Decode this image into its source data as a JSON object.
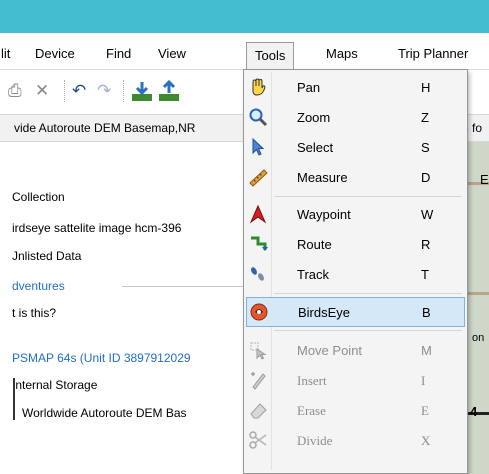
{
  "menubar": {
    "items": [
      {
        "label": "lit"
      },
      {
        "label": "Device"
      },
      {
        "label": "Find"
      },
      {
        "label": "View"
      },
      {
        "label": "Tools"
      },
      {
        "label": "Maps"
      },
      {
        "label": "Trip Planner"
      }
    ]
  },
  "toolbar": {
    "icons": [
      "print-icon",
      "delete-icon",
      "undo-icon",
      "redo-icon",
      "receive-from-device-icon",
      "send-to-device-icon"
    ]
  },
  "addressbar": {
    "text": "vide Autoroute DEM Basemap,NR",
    "text_right": "e fo"
  },
  "left_panel": {
    "items": [
      {
        "label": "Collection"
      },
      {
        "label": "irdseye sattelite image hcm-396"
      },
      {
        "label": "Jnlisted Data"
      },
      {
        "label": "dventures"
      },
      {
        "label": "t is this?"
      },
      {
        "label": "PSMAP 64s (Unit ID 3897912029"
      },
      {
        "label": "Internal Storage"
      },
      {
        "label": "Worldwide  Autoroute  DEM Bas"
      }
    ]
  },
  "map_labels": {
    "top": "E",
    "middle": "on",
    "bottom": "4"
  },
  "tools_menu": {
    "items": [
      {
        "label": "Pan",
        "key": "H",
        "icon": "hand-icon"
      },
      {
        "label": "Zoom",
        "key": "Z",
        "icon": "magnifier-icon"
      },
      {
        "label": "Select",
        "key": "S",
        "icon": "arrow-pointer-icon"
      },
      {
        "label": "Measure",
        "key": "D",
        "icon": "tape-measure-icon"
      },
      {
        "label": "Waypoint",
        "key": "W",
        "icon": "waypoint-flag-icon"
      },
      {
        "label": "Route",
        "key": "R",
        "icon": "route-icon"
      },
      {
        "label": "Track",
        "key": "T",
        "icon": "track-footprints-icon"
      },
      {
        "label": "BirdsEye",
        "key": "B",
        "icon": "birdseye-icon"
      },
      {
        "label": "Move Point",
        "key": "M",
        "icon": "move-point-icon"
      },
      {
        "label": "Insert",
        "key": "I",
        "icon": "insert-pencil-icon"
      },
      {
        "label": "Erase",
        "key": "E",
        "icon": "eraser-icon"
      },
      {
        "label": "Divide",
        "key": "X",
        "icon": "scissors-icon"
      }
    ]
  },
  "colors": {
    "titlebar": "#43bdd0",
    "highlight": "#d5e8f8",
    "link": "#1f6fc9"
  }
}
